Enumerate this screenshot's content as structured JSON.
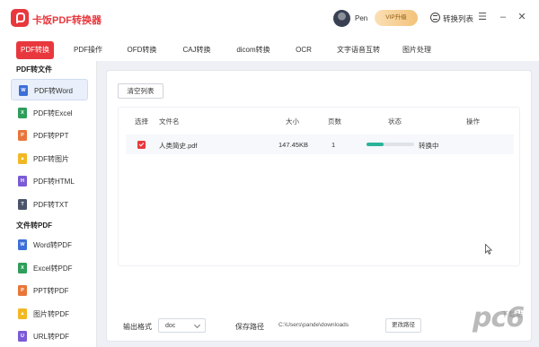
{
  "app": {
    "title": "卡饭PDF转换器"
  },
  "header": {
    "user_name": "Pen",
    "vip_label": "VIP升级",
    "convert_list_label": "转换列表"
  },
  "tabs": [
    {
      "label": "PDF转换",
      "active": true
    },
    {
      "label": "PDF操作",
      "active": false
    },
    {
      "label": "OFD转换",
      "active": false
    },
    {
      "label": "CAJ转换",
      "active": false
    },
    {
      "label": "dicom转换",
      "active": false
    },
    {
      "label": "OCR",
      "active": false
    },
    {
      "label": "文字语音互转",
      "active": false
    },
    {
      "label": "图片处理",
      "active": false
    }
  ],
  "sidebar": {
    "section1_title": "PDF转文件",
    "section2_title": "文件转PDF",
    "items": [
      {
        "label": "PDF转Word",
        "icon": "W",
        "color": "#3c6fd8",
        "active": true
      },
      {
        "label": "PDF转Excel",
        "icon": "X",
        "color": "#2e9e5b",
        "active": false
      },
      {
        "label": "PDF转PPT",
        "icon": "P",
        "color": "#e8763a",
        "active": false
      },
      {
        "label": "PDF转图片",
        "icon": "▲",
        "color": "#f2b824",
        "active": false
      },
      {
        "label": "PDF转HTML",
        "icon": "H",
        "color": "#7b5bd6",
        "active": false
      },
      {
        "label": "PDF转TXT",
        "icon": "T",
        "color": "#4a5568",
        "active": false
      },
      {
        "label": "Word转PDF",
        "icon": "W",
        "color": "#3c6fd8",
        "active": false
      },
      {
        "label": "Excel转PDF",
        "icon": "X",
        "color": "#2e9e5b",
        "active": false
      },
      {
        "label": "PPT转PDF",
        "icon": "P",
        "color": "#e8763a",
        "active": false
      },
      {
        "label": "图片转PDF",
        "icon": "▲",
        "color": "#f2b824",
        "active": false
      },
      {
        "label": "URL转PDF",
        "icon": "U",
        "color": "#7b5bd6",
        "active": false
      }
    ]
  },
  "main": {
    "clear_button": "清空列表",
    "columns": {
      "select": "选择",
      "filename": "文件名",
      "size": "大小",
      "pages": "页数",
      "status": "状态",
      "action": "操作"
    },
    "files": [
      {
        "name": "人类简史.pdf",
        "size": "147.45KB",
        "pages": "1",
        "status": "转换中",
        "progress": 0.35,
        "checked": true
      }
    ],
    "output_format_label": "输出格式",
    "output_format_value": "doc",
    "save_path_label": "保存路径",
    "save_path_value": "C:\\Users\\pande\\downloads",
    "change_dir_button": "更改路径"
  },
  "watermark": {
    "text": "pc6",
    "sub": "下载站"
  },
  "colors": {
    "accent": "#e8383d",
    "progress": "#2bb39a",
    "main_bg": "#eef0f5"
  }
}
